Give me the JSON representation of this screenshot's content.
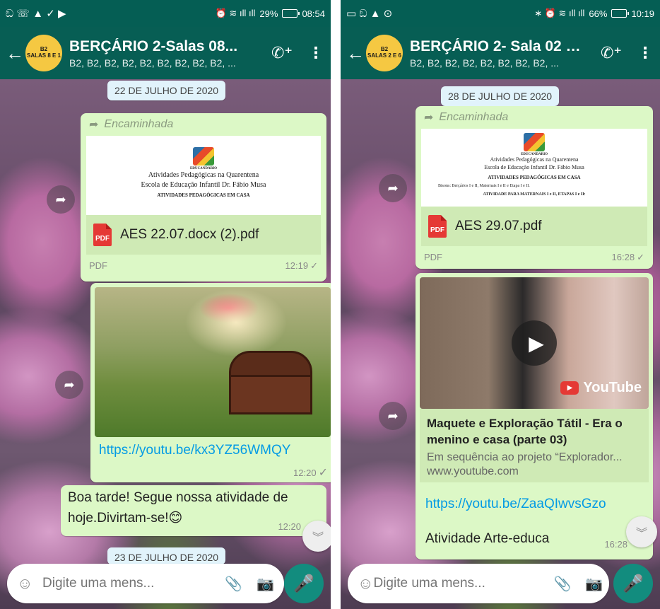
{
  "left": {
    "status": {
      "left_icons": "ඞ ☏ ▲ ✓ ▶",
      "signal": "⏰ ≋ ıll ıll",
      "battery": "29%",
      "time": "08:54"
    },
    "header": {
      "avatar_line1": "B2",
      "avatar_line2": "SALAS 8 E 1",
      "title": "BERÇÁRIO 2-Salas 08...",
      "subtitle": "B2, B2, B2, B2, B2, B2, B2, B2, B2, ..."
    },
    "messages": {
      "date1": "22 DE JULHO DE 2020",
      "fwd_label": "Encaminhada",
      "doc_preview": {
        "logo_text": "EDUCANDARIO",
        "line1": "Atividades Pedagógicas na Quarentena",
        "line2": "Escola de Educação Infantil Dr. Fábio Musa",
        "line3": "ATIVIDADES PEDAGÓGICAS EM CASA"
      },
      "doc_icon_label": "PDF",
      "doc_name": "AES 22.07.docx (2).pdf",
      "doc_type": "PDF",
      "doc_time": "12:19",
      "link": "https://youtu.be/kx3YZ56WMQY",
      "link_time": "12:20",
      "text_msg": "Boa tarde! Segue nossa atividade de hoje.Divirtam-se!",
      "text_emoji": "😊",
      "text_time": "12:20",
      "date2": "23 DE JULHO DE 2020"
    },
    "composer": {
      "placeholder": "Digite uma mens..."
    }
  },
  "right": {
    "status": {
      "left_icons": "▭ ඞ ▲ ⊙",
      "signal": "∗ ⏰ ≋ ıll ıll",
      "battery": "66%",
      "time": "10:19"
    },
    "header": {
      "avatar_line1": "B2",
      "avatar_line2": "SALAS 2 E 6",
      "title": "BERÇÁRIO 2- Sala 02 e...",
      "subtitle": "B2, B2, B2, B2, B2, B2, B2, B2, ..."
    },
    "messages": {
      "date1": "28 DE JULHO DE 2020",
      "fwd_label": "Encaminhada",
      "doc_preview": {
        "logo_text": "EDUCANDARIO",
        "line1": "Atividades Pedagógicas na Quarentena",
        "line2": "Escola de Educação Infantil Dr. Fábio Musa",
        "line3": "ATIVIDADES PEDAGÓGICAS EM CASA",
        "line4": "Bisons: Berçários I e II, Maternais I e II e Etapa I e II.",
        "line5": "ATIVIDADE PARA MATERNAIS I e II, ETAPAS I e II:"
      },
      "doc_icon_label": "PDF",
      "doc_name": "AES 29.07.pdf",
      "doc_type": "PDF",
      "doc_time": "16:28",
      "yt_brand": "YouTube",
      "yt_title": "Maquete e Exploração Tátil - Era o menino e casa (parte 03)",
      "yt_desc": "Em sequência ao projeto “Explorador...",
      "yt_site": "www.youtube.com",
      "link": "https://youtu.be/ZaaQIwvsGzo",
      "text_msg": "Atividade Arte-educa",
      "text_time": "16:28"
    },
    "composer": {
      "placeholder": "Digite uma mens..."
    }
  },
  "icons": {
    "back": "←",
    "add_call": "📞",
    "menu": "⋮",
    "forward": "➦",
    "share": "➦",
    "scroll_down": "︾",
    "emoji": "☺",
    "clip": "📎",
    "camera": "📷",
    "mic": "🎤",
    "play": "▶",
    "tick": "✓"
  },
  "colors": {
    "header": "#075e54",
    "statusbar": "#055e54",
    "bubble_out": "#dcf8c6",
    "link": "#039be5",
    "mic": "#128c7e",
    "avatar": "#f5c842"
  }
}
